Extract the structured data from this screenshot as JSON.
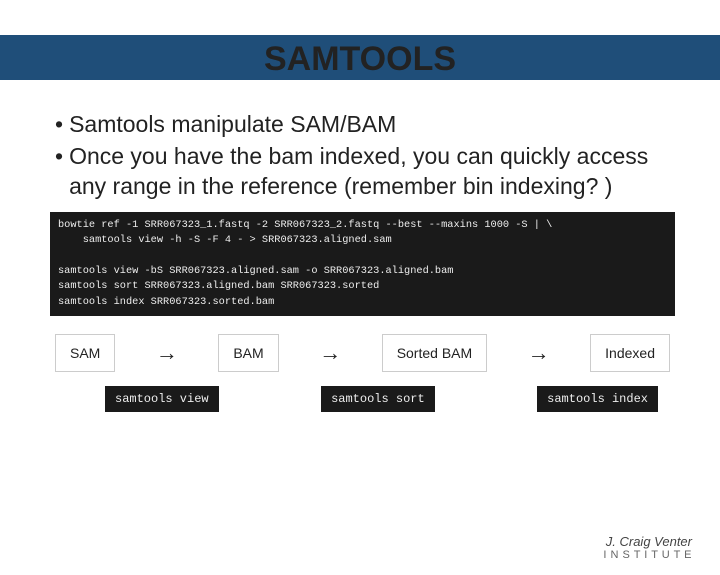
{
  "title": "SAMTOOLS",
  "bullets": [
    "Samtools manipulate SAM/BAM",
    "Once you have the bam indexed, you can quickly access any range in the reference (remember bin indexing? )"
  ],
  "code": "bowtie ref -1 SRR067323_1.fastq -2 SRR067323_2.fastq --best --maxins 1000 -S | \\\n    samtools view -h -S -F 4 - > SRR067323.aligned.sam\n\nsamtools view -bS SRR067323.aligned.sam -o SRR067323.aligned.bam\nsamtools sort SRR067323.aligned.bam SRR067323.sorted\nsamtools index SRR067323.sorted.bam",
  "pipeline": {
    "stages": [
      "SAM",
      "BAM",
      "Sorted BAM",
      "Indexed"
    ],
    "commands": [
      "samtools view",
      "samtools sort",
      "samtools index"
    ]
  },
  "footer": {
    "line1": "J. Craig Venter",
    "line2": "I N S T I T U T E"
  }
}
